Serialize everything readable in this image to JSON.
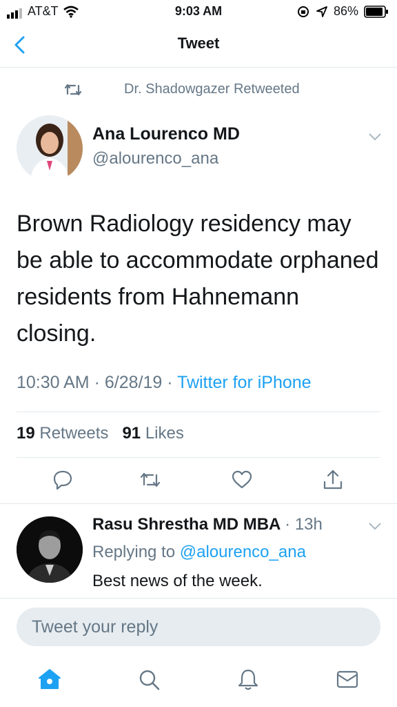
{
  "status_bar": {
    "carrier": "AT&T",
    "time": "9:03 AM",
    "battery": "86%"
  },
  "nav": {
    "title": "Tweet",
    "back_icon": "chevron-left-icon"
  },
  "retweet_context": {
    "text": "Dr. Shadowgazer Retweeted",
    "icon": "retweet-icon"
  },
  "tweet": {
    "author_name": "Ana Lourenco MD",
    "author_handle": "@alourenco_ana",
    "text": "Brown Radiology residency may be able to accommodate orphaned residents from Hahnemann closing.",
    "time": "10:30 AM",
    "date": "6/28/19",
    "source": "Twitter for iPhone",
    "separator": " · ",
    "retweets_count": "19",
    "retweets_label": "Retweets",
    "likes_count": "91",
    "likes_label": "Likes"
  },
  "actions": [
    "reply-icon",
    "retweet-icon",
    "like-icon",
    "share-icon"
  ],
  "reply": {
    "author_name": "Rasu Shrestha MD MBA",
    "time": "· 13h",
    "replying_prefix": "Replying to",
    "replying_handle": "@alourenco_ana",
    "text": "Best news of the week."
  },
  "compose": {
    "placeholder": "Tweet your reply"
  },
  "tab_bar": [
    "home-icon",
    "search-icon",
    "notifications-icon",
    "messages-icon"
  ],
  "colors": {
    "accent": "#1da1f2",
    "secondary_text": "#657786",
    "divider": "#e1e8ed",
    "compose_bg": "#e6ecf0"
  }
}
